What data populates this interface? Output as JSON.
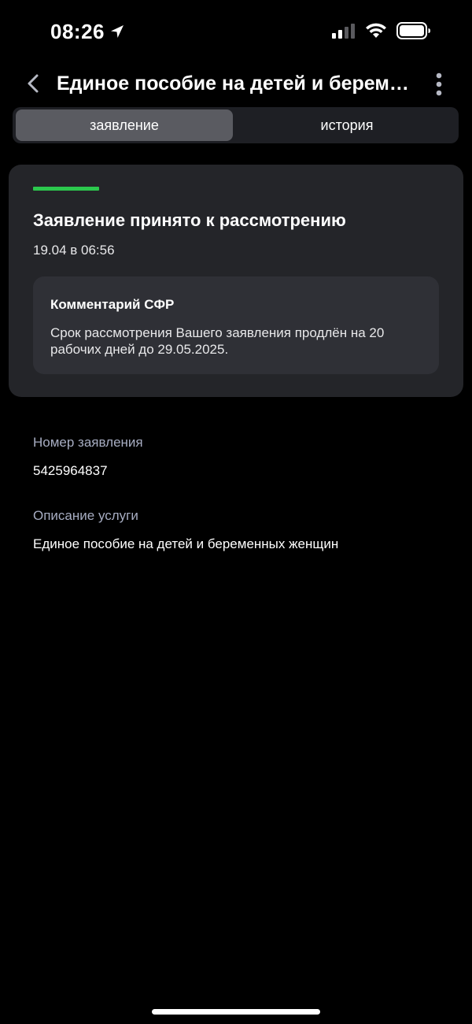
{
  "status_bar": {
    "time": "08:26"
  },
  "header": {
    "title": "Единое пособие на детей и беременных женщин"
  },
  "tabs": [
    {
      "label": "заявление",
      "active": true
    },
    {
      "label": "история",
      "active": false
    }
  ],
  "status_card": {
    "accent_color": "#2cc84d",
    "title": "Заявление принято к рассмотрению",
    "date": "19.04 в 06:56",
    "comment": {
      "title": "Комментарий СФР",
      "text": "Срок рассмотрения Вашего заявления продлён на 20 рабочих дней до 29.05.2025."
    }
  },
  "details": {
    "application_number_label": "Номер заявления",
    "application_number": "5425964837",
    "service_description_label": "Описание услуги",
    "service_description": "Единое пособие на детей и беременных женщин"
  },
  "icons": {
    "back": "chevron-left-icon",
    "more": "vertical-dots-icon",
    "location": "location-arrow-icon",
    "signal": "cellular-signal-icon",
    "wifi": "wifi-icon",
    "battery": "battery-icon"
  }
}
